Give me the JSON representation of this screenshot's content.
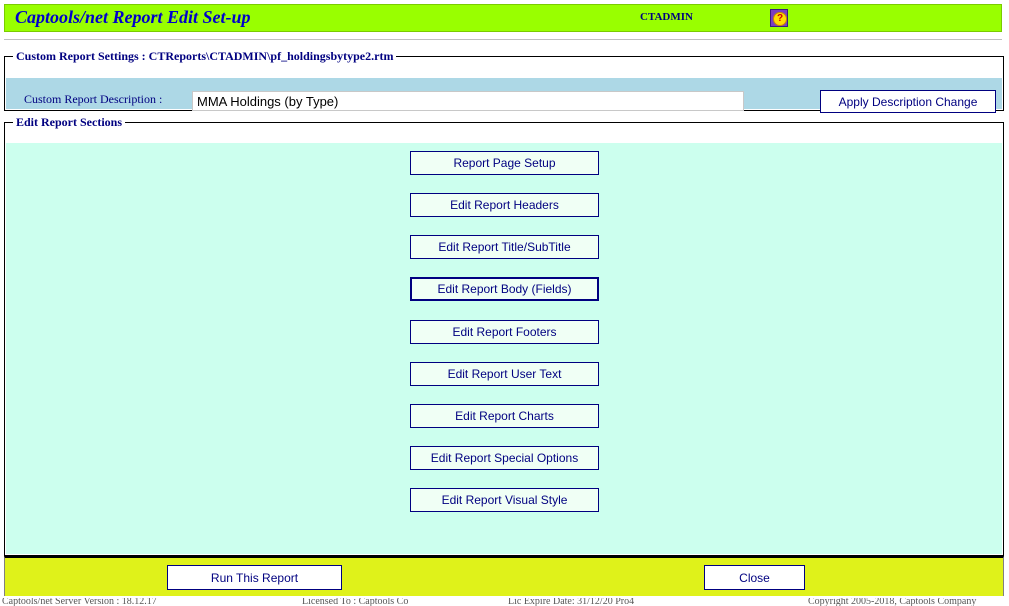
{
  "header": {
    "title": "Captools/net Report Edit Set-up",
    "user": "CTADMIN",
    "help_icon": "question-mark-icon",
    "colors": {
      "bar": "#99ff00",
      "title": "#0000cc"
    }
  },
  "settings": {
    "legend": "Custom Report Settings : CTReports\\CTADMIN\\pf_holdingsbytype2.rtm",
    "description_label": "Custom Report Description :",
    "description_value": "MMA Holdings (by Type)",
    "apply_button": "Apply Description Change",
    "colors": {
      "background": "#add8e6"
    }
  },
  "sections": {
    "legend": "Edit Report Sections",
    "buttons": [
      "Report Page Setup",
      "Edit Report Headers",
      "Edit Report Title/SubTitle",
      "Edit Report Body (Fields)",
      "Edit Report Footers",
      "Edit Report User Text",
      "Edit Report Charts",
      "Edit Report Special Options",
      "Edit Report Visual Style"
    ],
    "active_button": "Edit Report Body (Fields)",
    "colors": {
      "background": "#ccffee"
    }
  },
  "footer_bar": {
    "run_button": "Run This Report",
    "close_button": "Close",
    "colors": {
      "background": "#dff21a"
    }
  },
  "status": {
    "version": "Captools/net Server Version : 18.12.17",
    "licensed": "Licensed To : Captools Co",
    "expire": "Lic Expire Date: 31/12/20 Pro4",
    "copyright": "Copyright 2005-2018, Captools Company"
  }
}
